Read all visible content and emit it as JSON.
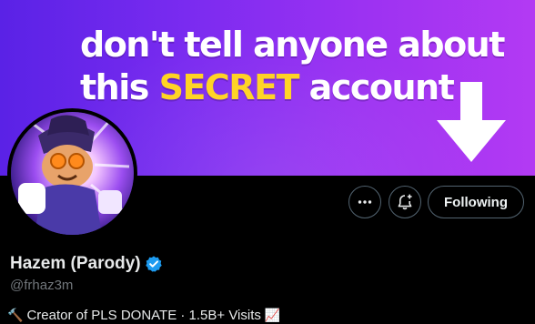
{
  "banner": {
    "line1": "don't tell anyone about",
    "line2_before": "this ",
    "line2_highlight": "SECRET",
    "line2_after": " account"
  },
  "actions": {
    "follow_label": "Following",
    "more_icon": "more-horizontal-icon",
    "bell_icon": "notification-bell-plus-icon"
  },
  "profile": {
    "display_name": "Hazem (Parody)",
    "verified_icon": "verified-badge-icon",
    "handle": "@frhaz3m",
    "bio_prefix_emoji": "🔨",
    "bio": "Creator of PLS DONATE · 1.5B+ Visits",
    "bio_suffix_emoji": "📈"
  },
  "colors": {
    "banner_start": "#5a22e6",
    "banner_end": "#b33af3",
    "highlight": "#ffd21f",
    "verified": "#1d9bf0",
    "muted_text": "#71767b"
  }
}
